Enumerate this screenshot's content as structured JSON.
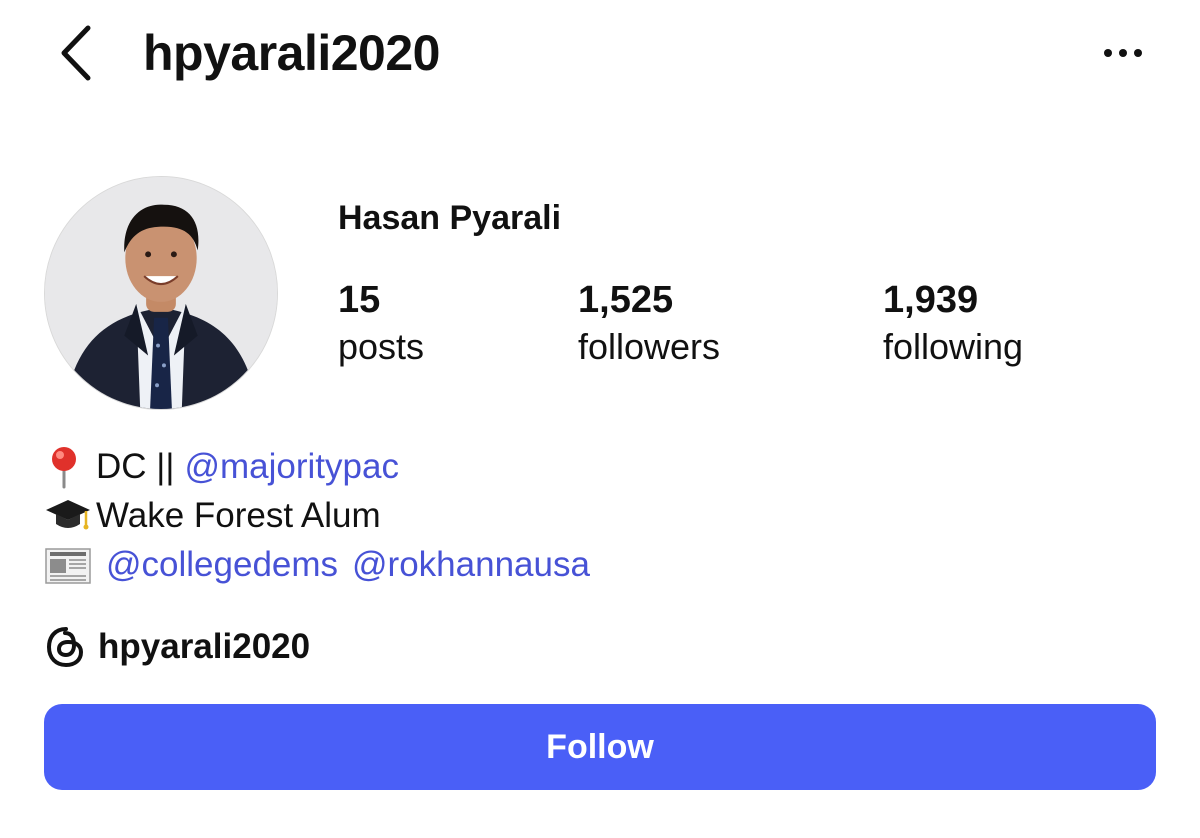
{
  "header": {
    "username": "hpyarali2020",
    "back_icon": "chevron-left-icon",
    "more_icon": "more-horizontal-icon"
  },
  "profile": {
    "display_name": "Hasan Pyarali",
    "avatar_icon": "profile-photo",
    "stats": {
      "posts": {
        "value": "15",
        "label": "posts"
      },
      "followers": {
        "value": "1,525",
        "label": "followers"
      },
      "following": {
        "value": "1,939",
        "label": "following"
      }
    }
  },
  "bio": {
    "line1": {
      "icon": "round-pushpin-icon",
      "text": "DC ||",
      "mention": "@majoritypac"
    },
    "line2": {
      "icon": "graduation-cap-icon",
      "text": "Wake Forest Alum"
    },
    "line3": {
      "icon": "newspaper-icon",
      "mentions": [
        "@collegedems",
        "@rokhannausa"
      ]
    }
  },
  "threads": {
    "icon": "threads-icon",
    "handle": "hpyarali2020"
  },
  "actions": {
    "follow_label": "Follow"
  },
  "colors": {
    "accent": "#4a5ff7",
    "mention": "#4752d6",
    "text": "#111111"
  }
}
